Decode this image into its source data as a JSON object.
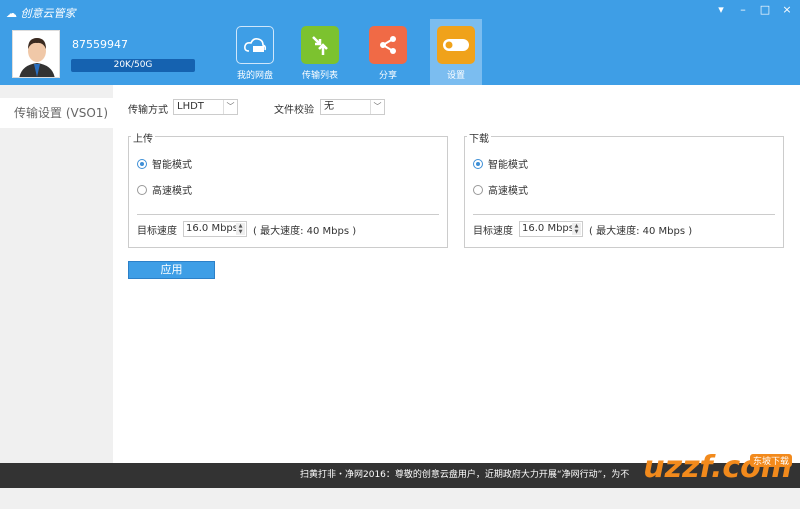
{
  "app": {
    "title": "创意云管家",
    "window_controls": [
      "▾",
      "–",
      "□",
      "×"
    ]
  },
  "user": {
    "id": "87559947",
    "quota": "20K/50G"
  },
  "nav": [
    {
      "label": "我的网盘",
      "color": "#3e9ee6"
    },
    {
      "label": "传输列表",
      "color": "#7cc22f"
    },
    {
      "label": "分享",
      "color": "#f06a46"
    },
    {
      "label": "设置",
      "color": "#f0a21a"
    }
  ],
  "sidebar": {
    "items": [
      {
        "label": "传输设置 (VSO1)"
      }
    ]
  },
  "settings": {
    "method_label": "传输方式",
    "method_value": "LHDT",
    "verify_label": "文件校验",
    "verify_value": "无",
    "upload": {
      "title": "上传",
      "smart": "智能模式",
      "fast": "高速模式",
      "speed_label": "目标速度",
      "speed_value": "16.0 Mbps",
      "max": "( 最大速度:  40 Mbps  )"
    },
    "download": {
      "title": "下载",
      "smart": "智能模式",
      "fast": "高速模式",
      "speed_label": "目标速度",
      "speed_value": "16.0 Mbps",
      "max": "( 最大速度:  40 Mbps  )"
    },
    "apply": "应用"
  },
  "footer": {
    "notice": "扫黄打非・净网2016：尊敬的创意云盘用户，近期政府大力开展“净网行动”，为不"
  },
  "watermark": {
    "text": "uzzf.com",
    "tag": "东坡下载"
  }
}
